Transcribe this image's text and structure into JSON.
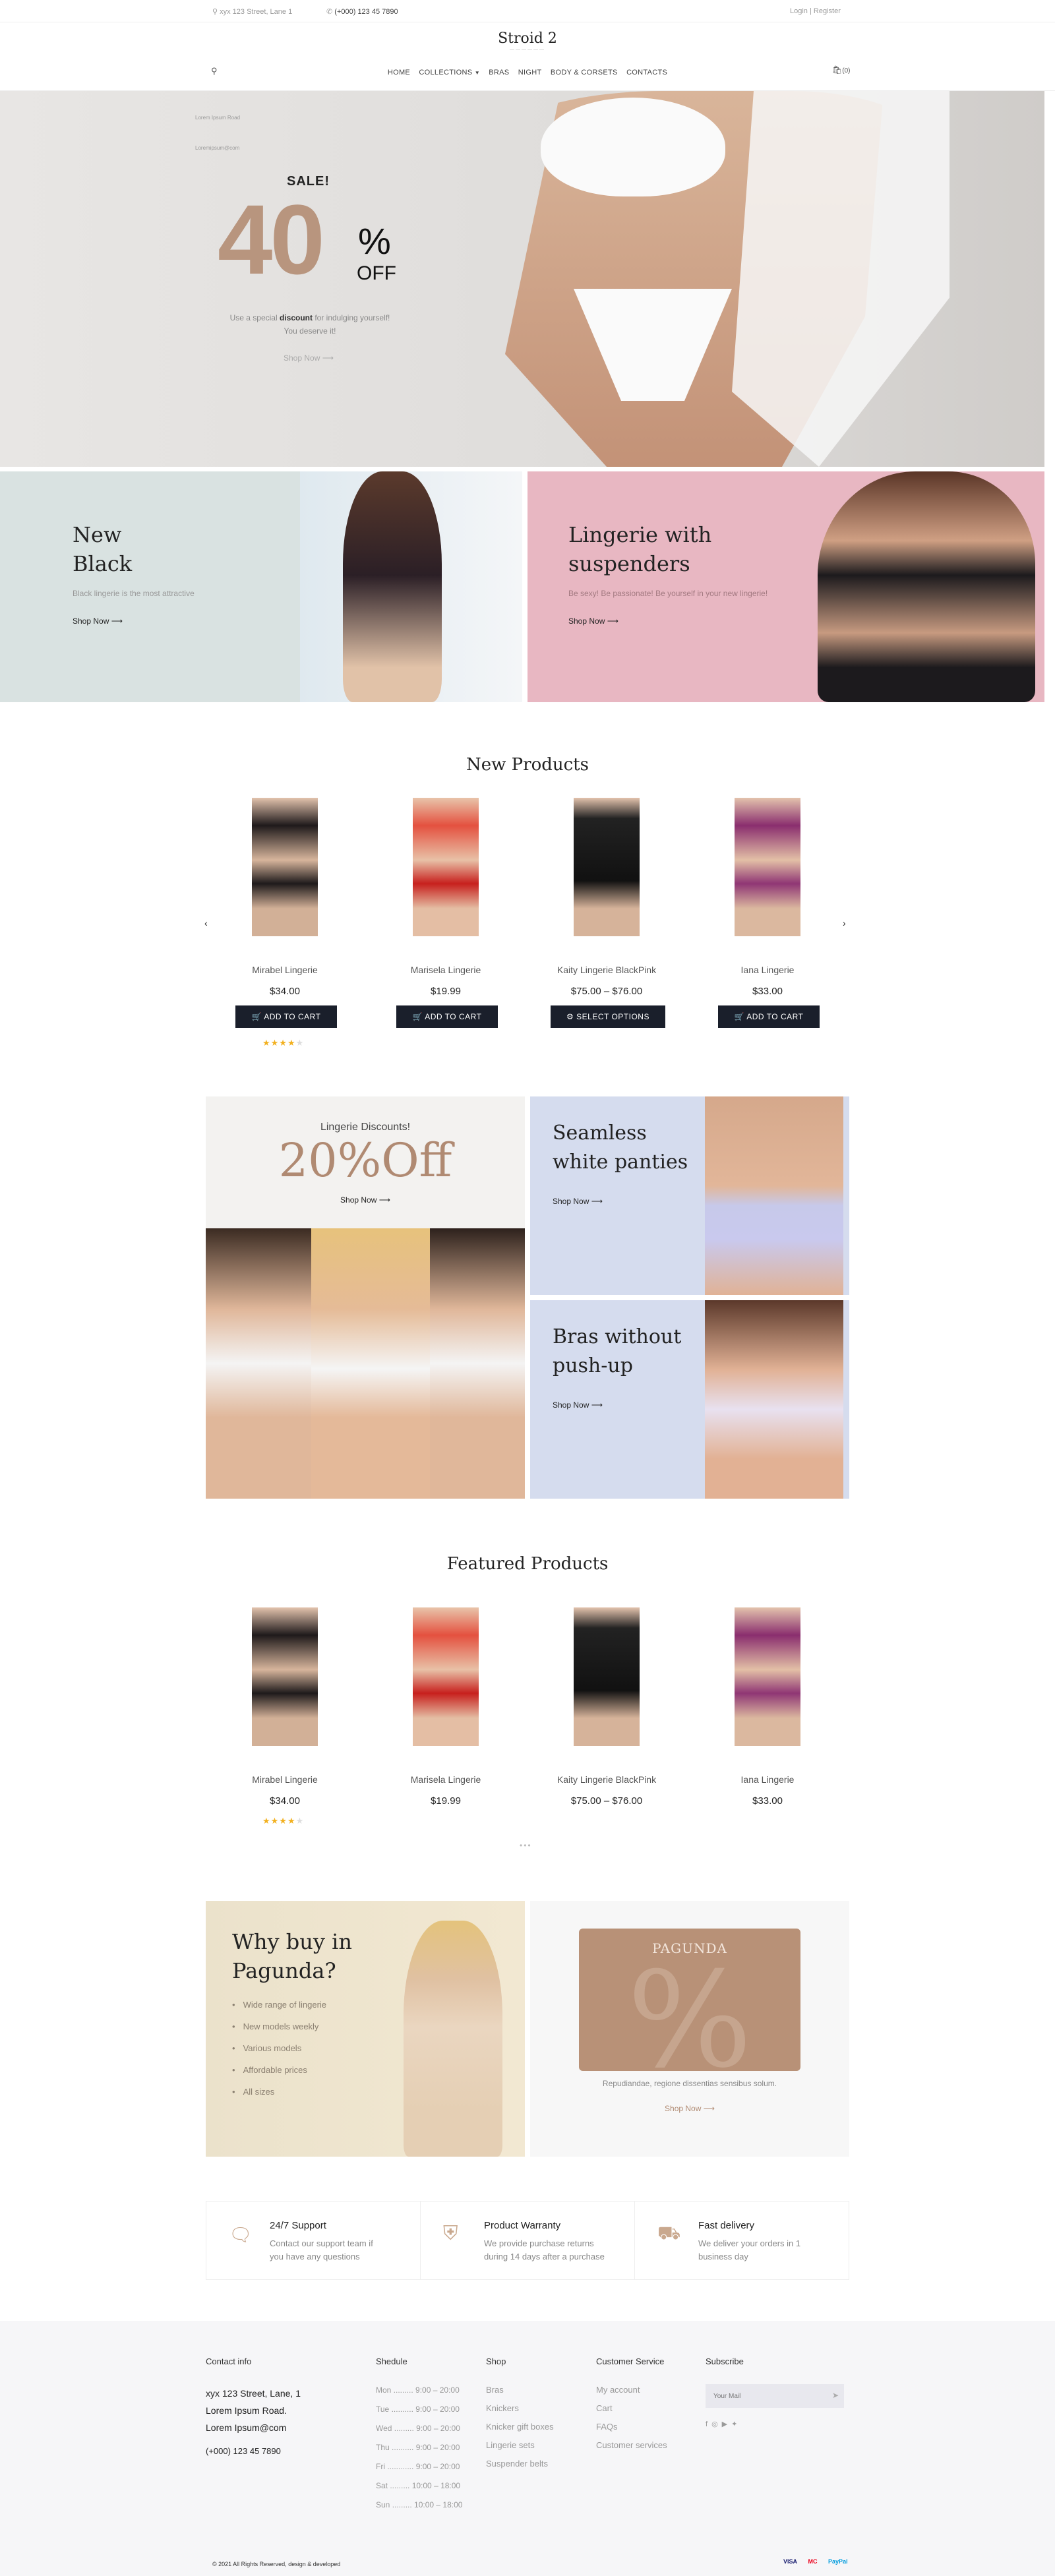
{
  "topbar": {
    "address": "xyx 123 Street, Lane 1",
    "phone": "(+000) 123 45 7890",
    "login": "Login",
    "sep": "|",
    "register": "Register"
  },
  "header": {
    "logo": "Stroid 2",
    "cart_count": "(0)"
  },
  "nav": {
    "items": [
      "HOME",
      "COLLECTIONS",
      "BRAS",
      "NIGHT",
      "BODY & CORSETS",
      "CONTACTS"
    ]
  },
  "hero": {
    "side1": "Lorem Ipsum Road",
    "side2": "Loremipsum@com",
    "sale": "SALE!",
    "big": "40",
    "pct": "%",
    "off": "OFF",
    "text1": "Use a special",
    "text_bold": "discount",
    "text2": "for indulging yourself!",
    "text3": "You deserve it!",
    "cta": "Shop Now"
  },
  "promo1": {
    "title1": "New",
    "title2": "Black",
    "desc": "Black lingerie is the most attractive",
    "cta": "Shop Now"
  },
  "promo2": {
    "title1": "Lingerie with",
    "title2": "suspenders",
    "desc": "Be sexy! Be passionate! Be yourself in your new lingerie!",
    "cta": "Shop Now"
  },
  "new_products": {
    "title": "New Products",
    "items": [
      {
        "name": "Mirabel Lingerie",
        "price": "$34.00",
        "button": "ADD TO CART",
        "rating": 4
      },
      {
        "name": "Marisela Lingerie",
        "price": "$19.99",
        "button": "ADD TO CART"
      },
      {
        "name": "Kaity Lingerie BlackPink",
        "price": "$75.00 – $76.00",
        "button": "SELECT OPTIONS"
      },
      {
        "name": "Iana Lingerie",
        "price": "$33.00",
        "button": "ADD TO CART"
      }
    ]
  },
  "banners": {
    "discount_label": "Lingerie Discounts!",
    "discount_big": "20%Off",
    "discount_cta": "Shop Now",
    "seamless1": "Seamless",
    "seamless2": "white panties",
    "seamless_cta": "Shop Now",
    "bras1": "Bras without",
    "bras2": "push-up",
    "bras_cta": "Shop Now"
  },
  "featured_products": {
    "title": "Featured Products",
    "items": [
      {
        "name": "Mirabel Lingerie",
        "price": "$34.00",
        "rating": 4
      },
      {
        "name": "Marisela Lingerie",
        "price": "$19.99"
      },
      {
        "name": "Kaity Lingerie BlackPink",
        "price": "$75.00 – $76.00"
      },
      {
        "name": "Iana Lingerie",
        "price": "$33.00"
      }
    ]
  },
  "why": {
    "title1": "Why buy in",
    "title2": "Pagunda?",
    "bullets": [
      "Wide range of lingerie",
      "New models weekly",
      "Various models",
      "Affordable prices",
      "All sizes"
    ]
  },
  "pagunda_card": {
    "brand": "PAGUNDA",
    "symbol": "%",
    "desc": "Repudiandae, regione dissentias sensibus solum.",
    "cta": "Shop Now"
  },
  "features": [
    {
      "title": "24/7 Support",
      "desc1": "Contact our support team if",
      "desc2": "you have any questions"
    },
    {
      "title": "Product Warranty",
      "desc1": "We provide purchase returns",
      "desc2": "during 14 days after a purchase"
    },
    {
      "title": "Fast delivery",
      "desc1": "We deliver your orders in 1",
      "desc2": "business day"
    }
  ],
  "footer": {
    "contact_h": "Contact info",
    "addr1": "xyx 123 Street, Lane, 1",
    "addr2": "Lorem Ipsum Road.",
    "email": "Lorem Ipsum@com",
    "phone": "(+000) 123 45 7890",
    "schedule_h": "Shedule",
    "schedule": [
      {
        "day": "Mon",
        "hours": "9:00 – 20:00"
      },
      {
        "day": "Tue",
        "hours": "9:00 – 20:00"
      },
      {
        "day": "Wed",
        "hours": "9:00 – 20:00"
      },
      {
        "day": "Thu",
        "hours": "9:00 – 20:00"
      },
      {
        "day": "Fri",
        "hours": "9:00 – 20:00"
      },
      {
        "day": "Sat",
        "hours": "10:00 – 18:00"
      },
      {
        "day": "Sun",
        "hours": "10:00 – 18:00"
      }
    ],
    "shop_h": "Shop",
    "shop": [
      "Bras",
      "Knickers",
      "Knicker gift boxes",
      "Lingerie sets",
      "Suspender belts"
    ],
    "service_h": "Customer Service",
    "service": [
      "My account",
      "Cart",
      "FAQs",
      "Customer services"
    ],
    "subscribe_h": "Subscribe",
    "subscribe_placeholder": "Your Mail",
    "copyright": "© 2021 All Rights Reserved, design & developed",
    "pay": [
      "VISA",
      "MC",
      "PayPal"
    ]
  },
  "colors": {
    "accent": "#b08a72",
    "dark": "#1a1f2b",
    "star": "#f2b01e"
  }
}
